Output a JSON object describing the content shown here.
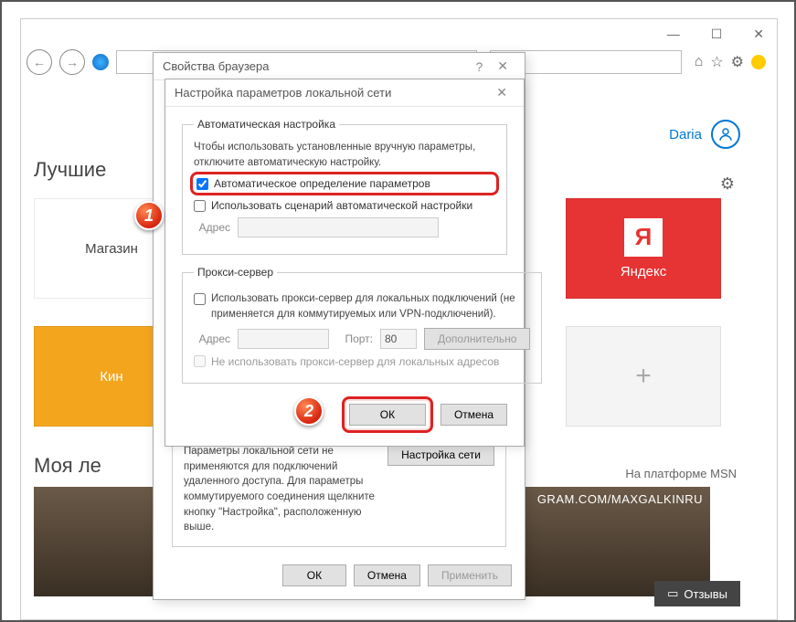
{
  "browser": {
    "user_name": "Daria",
    "section_best": "Лучшиe",
    "section_feed": "Моя лe",
    "msn_label": "На платформе MSN",
    "reviews_label": "Отзывы",
    "tiles": {
      "store": "Магазин",
      "yandex": "Яндекс",
      "yandex_letter": "Я",
      "kino": "Кин",
      "plus": "+"
    },
    "feed_overlay": "GRAM.COM/MAXGALKINRU"
  },
  "dialog1": {
    "title": "Свойства браузера",
    "lan_fieldset": "Настройка параметров локальной сети",
    "lan_text": "Параметры локальной сети не применяются для подключений удаленного доступа. Для параметры коммутируемого соединения щелкните кнопку \"Настройка\", расположенную выше.",
    "lan_button": "Настройка сети",
    "ok": "ОК",
    "cancel": "Отмена",
    "apply": "Применить"
  },
  "dialog2": {
    "title": "Настройка параметров локальной сети",
    "auto_fieldset": "Автоматическая настройка",
    "auto_text": "Чтобы использовать установленные вручную параметры, отключите автоматическую настройку.",
    "auto_detect": "Автоматическое определение параметров",
    "auto_script": "Использовать сценарий автоматической настройки",
    "address_label": "Адрес",
    "proxy_fieldset": "Прокси-сервер",
    "proxy_use": "Использовать прокси-сервер для локальных подключений (не применяется для коммутируемых или VPN-подключений).",
    "port_label": "Порт:",
    "port_value": "80",
    "advanced": "Дополнительно",
    "proxy_bypass": "Не использовать прокси-сервер для локальных адресов",
    "ok": "ОК",
    "cancel": "Отмена"
  },
  "steps": {
    "one": "1",
    "two": "2"
  }
}
